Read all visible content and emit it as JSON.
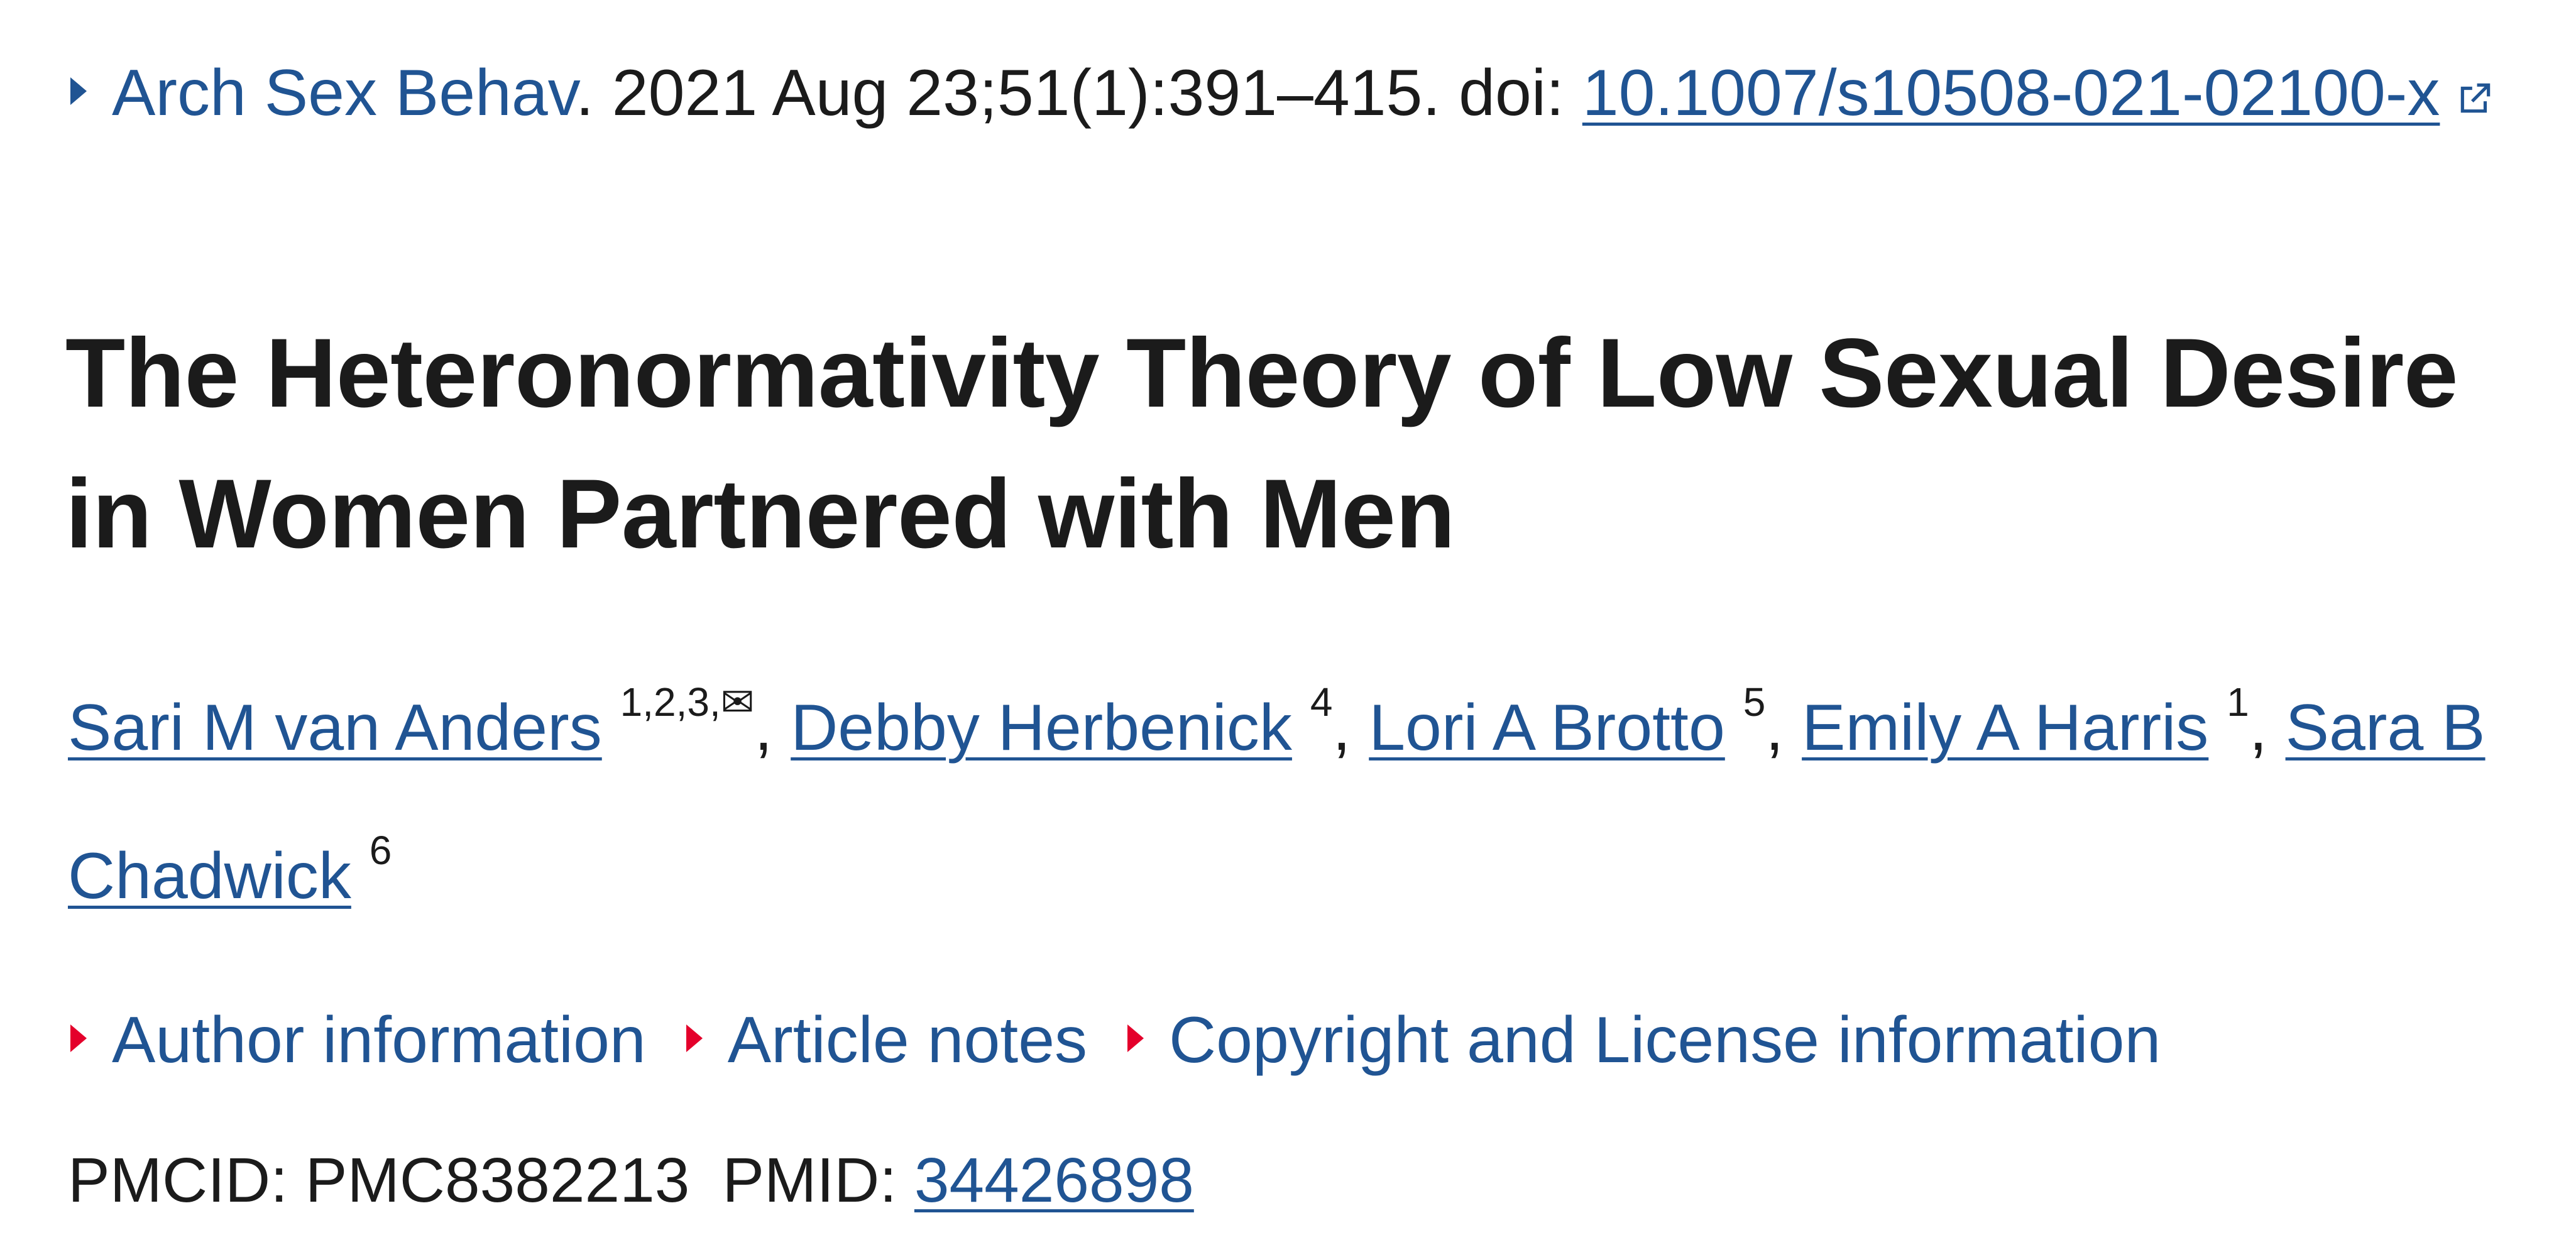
{
  "citation": {
    "journal": "Arch Sex Behav",
    "details": ". 2021 Aug 23;51(1):391–415. doi: ",
    "doi": "10.1007/s10508-021-02100-x"
  },
  "title": "The Heteronormativity Theory of Low Sexual Desire in Women Partnered with Men",
  "authors": [
    {
      "name": "Sari M van Anders",
      "affil": "1,2,3,✉"
    },
    {
      "name": "Debby Herbenick",
      "affil": "4"
    },
    {
      "name": "Lori A Brotto",
      "affil": "5"
    },
    {
      "name": "Emily A Harris",
      "affil": "1"
    },
    {
      "name": "Sara B Chadwick",
      "affil": "6"
    }
  ],
  "expanders": {
    "author_info": "Author information",
    "article_notes": "Article notes",
    "copyright": "Copyright and License information"
  },
  "ids": {
    "pmcid_label": "PMCID: ",
    "pmcid": "PMC8382213",
    "pmid_label": "PMID: ",
    "pmid": "34426898"
  },
  "colors": {
    "link": "#205493",
    "text": "#1b1b1b",
    "expander_arrow": "#e4002b"
  },
  "icons": [
    "triangle-right-icon",
    "external-link-icon"
  ]
}
